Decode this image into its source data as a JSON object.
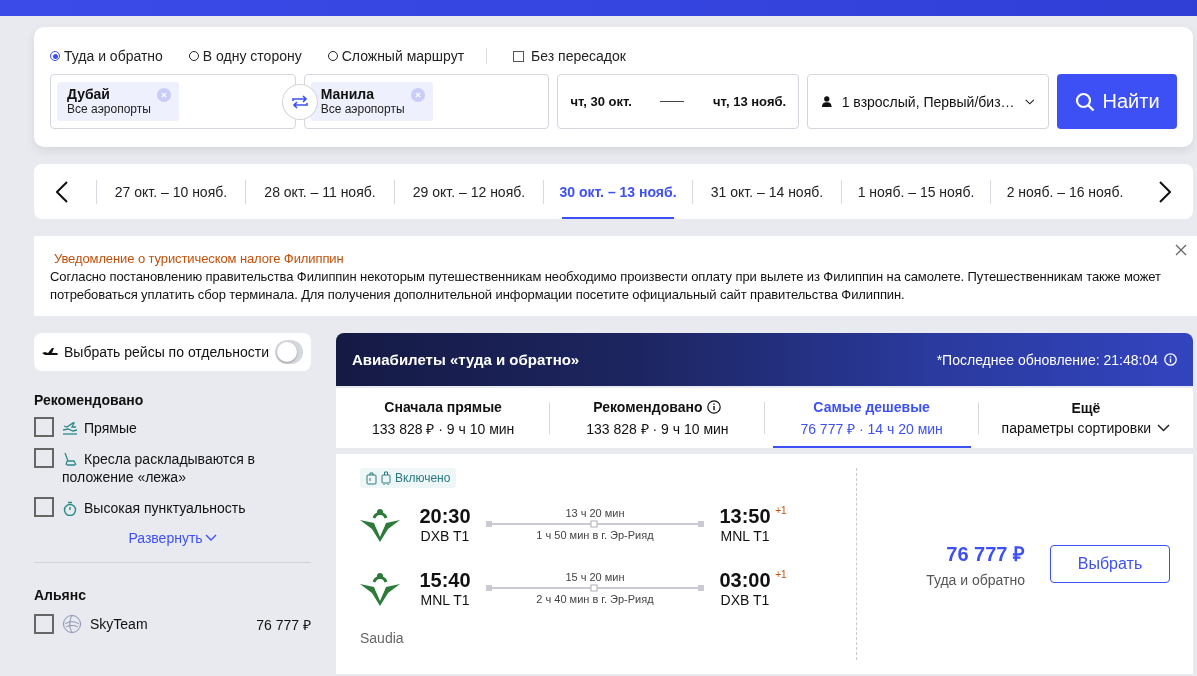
{
  "search": {
    "trip_types": [
      {
        "label": "Туда и обратно",
        "selected": true
      },
      {
        "label": "В одну сторону",
        "selected": false
      },
      {
        "label": "Сложный маршрут",
        "selected": false
      }
    ],
    "nonstop": {
      "label": "Без пересадок",
      "checked": false
    },
    "origin": {
      "city": "Дубай",
      "airports": "Все аэропорты"
    },
    "destination": {
      "city": "Манила",
      "airports": "Все аэропорты"
    },
    "depart_date": "чт, 30 окт.",
    "return_date": "чт, 13 нояб.",
    "passengers": "1 взрослый, Первый/биз…",
    "search_button": "Найти"
  },
  "date_options": [
    {
      "label": "27 окт. – 10 нояб.",
      "selected": false
    },
    {
      "label": "28 окт. – 11 нояб.",
      "selected": false
    },
    {
      "label": "29 окт. – 12 нояб.",
      "selected": false
    },
    {
      "label": "30 окт. – 13 нояб.",
      "selected": true
    },
    {
      "label": "31 окт. – 14 нояб.",
      "selected": false
    },
    {
      "label": "1 нояб. – 15 нояб.",
      "selected": false
    },
    {
      "label": "2 нояб. – 16 нояб.",
      "selected": false
    }
  ],
  "notice": {
    "title": "Уведомление о туристическом налоге Филиппин",
    "text": "Согласно постановлению правительства Филиппин некоторым путешественникам необходимо произвести оплату при вылете из Филиппин на самолете. Путешественникам также может потребоваться уплатить сбор терминала. Для получения дополнительной информации посетите официальный сайт правительства Филиппин."
  },
  "sidebar": {
    "separate_flights": {
      "label": "Выбрать рейсы по отдельности",
      "on": false
    },
    "recommended": {
      "title": "Рекомендовано",
      "items": [
        {
          "kind": "direct",
          "label": "Прямые",
          "checked": false
        },
        {
          "kind": "flat_seats",
          "label": "Кресла раскладываются в положение «лежа»",
          "checked": false
        },
        {
          "kind": "punctuality",
          "label": "Высокая пунктуальность",
          "checked": false
        }
      ]
    },
    "expand_link": "Развернуть",
    "alliance": {
      "title": "Альянс",
      "items": [
        {
          "label": "SkyTeam",
          "price": "76 777 ₽",
          "checked": false
        }
      ]
    }
  },
  "results": {
    "title": "Авиабилеты «туда и обратно»",
    "updated": "*Последнее обновление: 21:48:04",
    "sort_tabs": [
      {
        "kind": "sort",
        "title": "Сначала прямые",
        "detail": "133 828 ₽ · 9 ч 10 мин",
        "selected": false
      },
      {
        "kind": "sort_info",
        "title": "Рекомендовано",
        "detail": "133 828 ₽ · 9 ч 10 мин",
        "selected": false
      },
      {
        "kind": "sort",
        "title": "Самые дешевые",
        "detail": "76 777 ₽ · 14 ч 20 мин",
        "selected": true
      },
      {
        "kind": "more",
        "title": "Ещё",
        "detail": "параметры сортировки",
        "selected": false
      }
    ],
    "offers": [
      {
        "baggage": "Включено",
        "legs": [
          {
            "depart_time": "20:30",
            "depart_airport": "DXB T1",
            "duration": "13 ч 20 мин",
            "stop": "1 ч 50 мин в г. Эр-Рияд",
            "arrive_time": "13:50",
            "day_offset": "+1",
            "arrive_airport": "MNL T1"
          },
          {
            "depart_time": "15:40",
            "depart_airport": "MNL T1",
            "duration": "15 ч 20 мин",
            "stop": "2 ч 40 мин в г. Эр-Рияд",
            "arrive_time": "03:00",
            "day_offset": "+1",
            "arrive_airport": "DXB T1"
          }
        ],
        "airline": "Saudia",
        "price": "76 777 ₽",
        "price_note": "Туда и обратно",
        "select_button": "Выбрать"
      }
    ]
  }
}
